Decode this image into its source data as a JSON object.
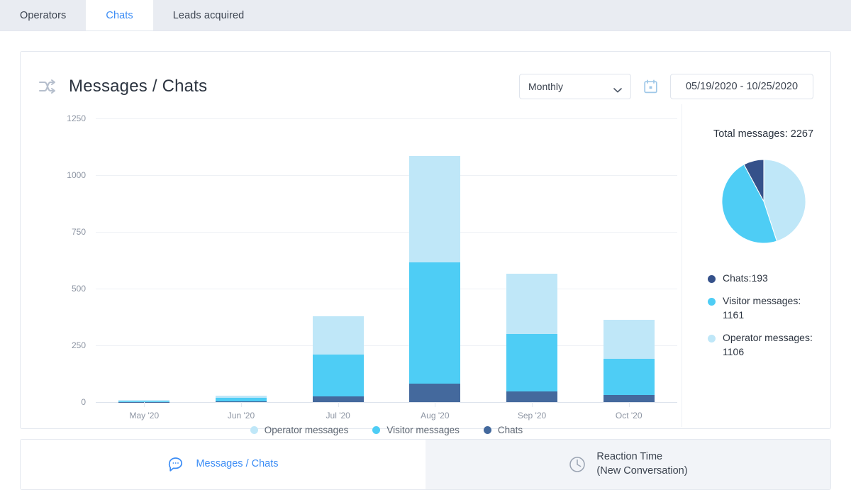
{
  "top_tabs": [
    {
      "label": "Operators",
      "active": false
    },
    {
      "label": "Chats",
      "active": true
    },
    {
      "label": "Leads acquired",
      "active": false
    }
  ],
  "card": {
    "icon": "shuffle-icon",
    "title": "Messages / Chats",
    "period_select": {
      "value": "Monthly",
      "icon": "chevron-down-icon"
    },
    "calendar_icon": "calendar-icon",
    "date_range": "05/19/2020 - 10/25/2020"
  },
  "side_panel": {
    "total_label": "Total messages: 2267",
    "legend": [
      {
        "label": "Chats:193",
        "color": "#35518a"
      },
      {
        "label": "Visitor messages: 1161",
        "color": "#4ecdf5"
      },
      {
        "label": "Operator messages: 1106",
        "color": "#bfe7f8"
      }
    ]
  },
  "bottom_tabs": [
    {
      "label": "Messages / Chats",
      "icon": "chat-bubble-icon",
      "active": true
    },
    {
      "label": "Reaction Time\n(New Conversation)",
      "icon": "clock-icon",
      "active": false
    }
  ],
  "colors": {
    "operator": "#bfe7f8",
    "visitor": "#4ecdf5",
    "chats": "#44699d",
    "accent": "#3b8cf5",
    "grid": "#eef1f5",
    "axis_text": "#8d95a3"
  },
  "chart_data": {
    "type": "bar",
    "subtype": "stacked",
    "title": "Messages / Chats",
    "xlabel": "",
    "ylabel": "",
    "ylim": [
      0,
      1250
    ],
    "yticks": [
      1250,
      1000,
      750,
      500,
      250,
      0
    ],
    "grid": true,
    "legend_position": "bottom",
    "categories": [
      "May '20",
      "Jun '20",
      "Jul '20",
      "Aug '20",
      "Sep '20",
      "Oct '20"
    ],
    "series": [
      {
        "name": "Chats",
        "color": "#44699d",
        "values": [
          1,
          4,
          25,
          80,
          48,
          30
        ]
      },
      {
        "name": "Visitor messages",
        "color": "#4ecdf5",
        "values": [
          2,
          14,
          183,
          535,
          252,
          160
        ]
      },
      {
        "name": "Operator messages",
        "color": "#bfe7f8",
        "values": [
          6,
          9,
          170,
          470,
          265,
          172
        ]
      }
    ],
    "totals": [
      9,
      27,
      378,
      1085,
      565,
      362
    ],
    "legend": [
      "Operator messages",
      "Visitor messages",
      "Chats"
    ]
  },
  "pie_data": {
    "type": "pie",
    "title": "Total messages: 2267",
    "labels": [
      "Operator messages",
      "Visitor messages",
      "Chats"
    ],
    "values": [
      1106,
      1161,
      193
    ],
    "colors": [
      "#bfe7f8",
      "#4ecdf5",
      "#35518a"
    ]
  }
}
